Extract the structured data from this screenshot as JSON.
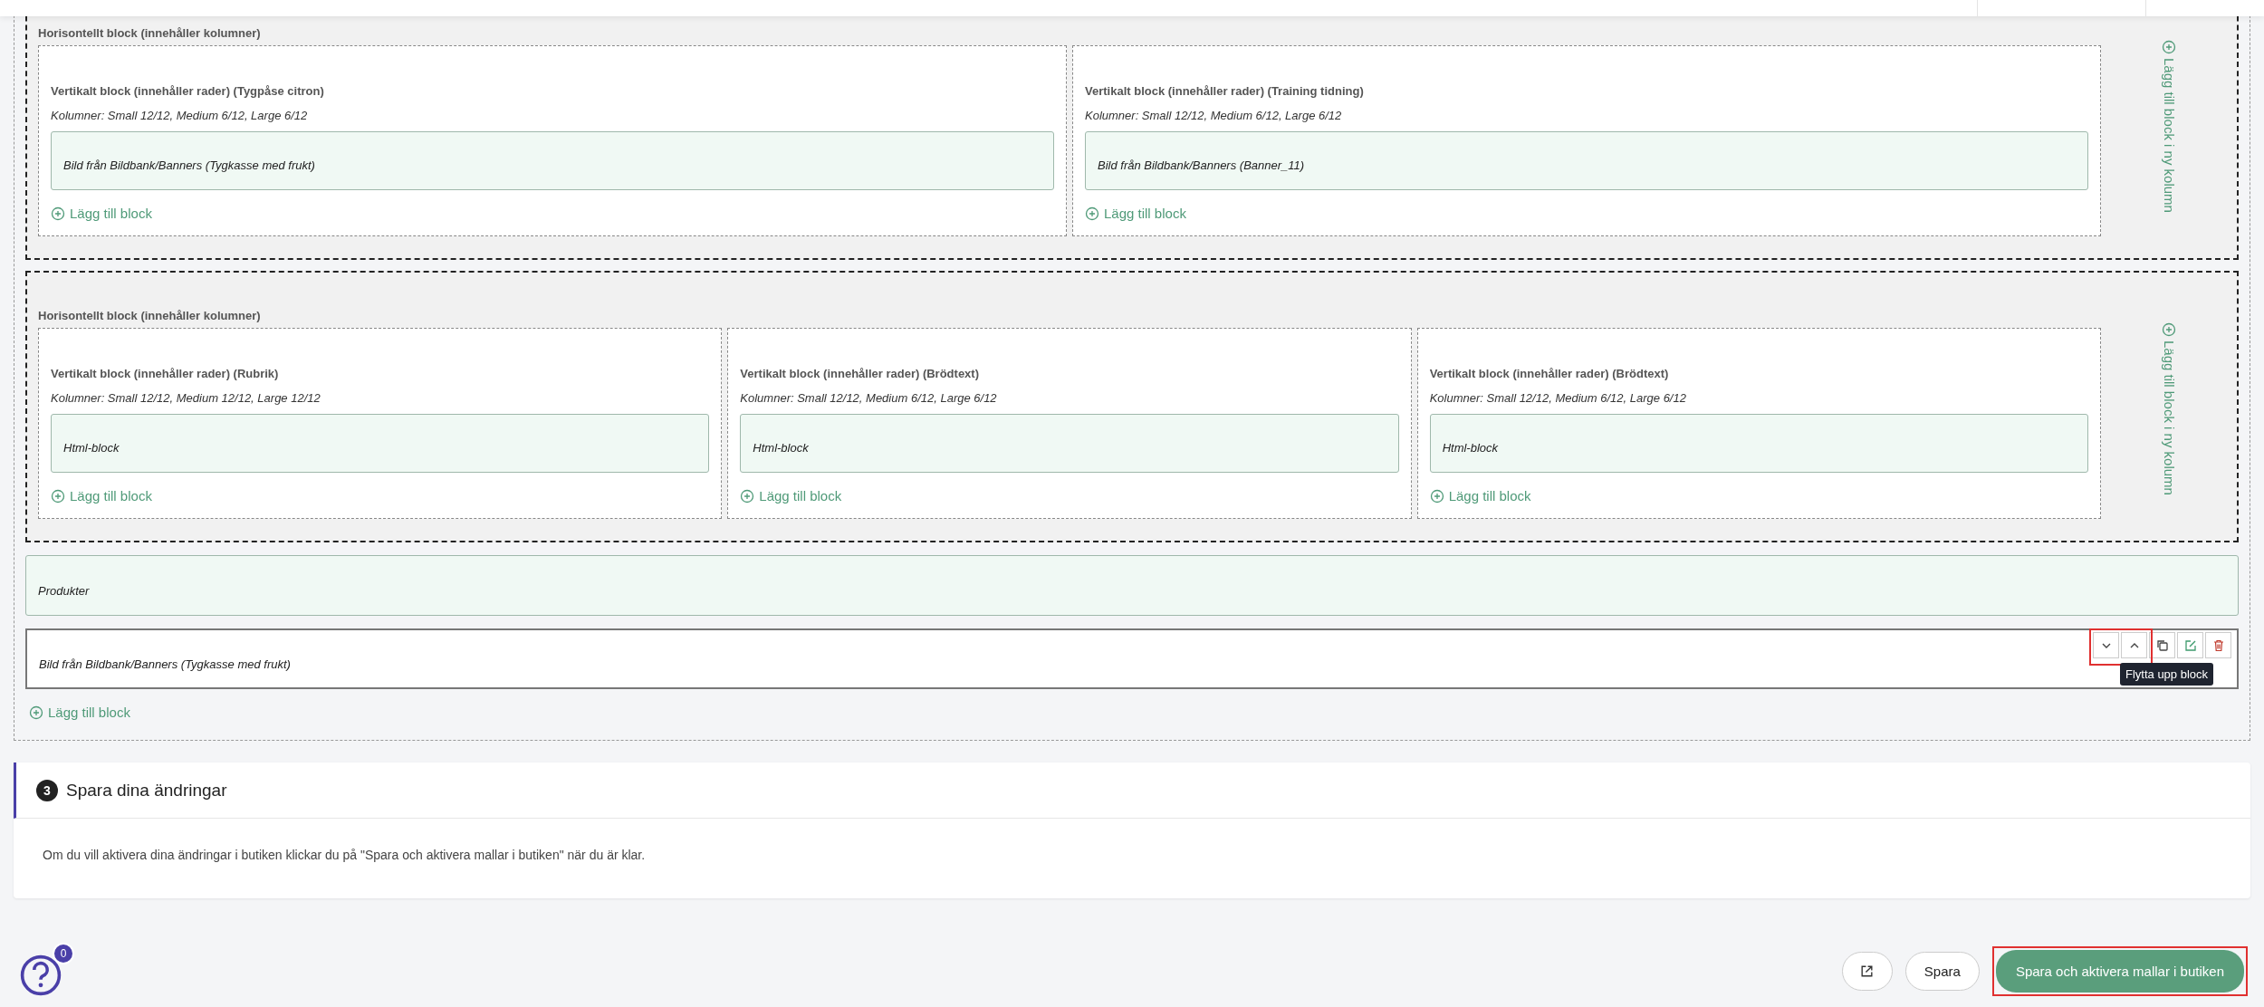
{
  "horizontal_blocks": [
    {
      "label": "Horisontellt block (innehåller kolumner)",
      "add_column_label": "Lägg till block i ny kolumn",
      "columns": [
        {
          "title": "Vertikalt block (innehåller rader) (Tygpåse citron)",
          "columns_info": "Kolumner: Small 12/12, Medium 6/12, Large 6/12",
          "items": [
            "Bild från Bildbank/Banners (Tygkasse med frukt)"
          ],
          "add_label": "Lägg till block"
        },
        {
          "title": "Vertikalt block (innehåller rader) (Training tidning)",
          "columns_info": "Kolumner: Small 12/12, Medium 6/12, Large 6/12",
          "items": [
            "Bild från Bildbank/Banners (Banner_11)"
          ],
          "add_label": "Lägg till block"
        }
      ]
    },
    {
      "label": "Horisontellt block (innehåller kolumner)",
      "add_column_label": "Lägg till block i ny kolumn",
      "columns": [
        {
          "title": "Vertikalt block (innehåller rader) (Rubrik)",
          "columns_info": "Kolumner: Small 12/12, Medium 12/12, Large 12/12",
          "items": [
            "Html-block"
          ],
          "add_label": "Lägg till block"
        },
        {
          "title": "Vertikalt block (innehåller rader) (Brödtext)",
          "columns_info": "Kolumner: Small 12/12, Medium 6/12, Large 6/12",
          "items": [
            "Html-block"
          ],
          "add_label": "Lägg till block"
        },
        {
          "title": "Vertikalt block (innehåller rader) (Brödtext)",
          "columns_info": "Kolumner: Small 12/12, Medium 6/12, Large 6/12",
          "items": [
            "Html-block"
          ],
          "add_label": "Lägg till block"
        }
      ]
    }
  ],
  "rows": [
    {
      "text": "Produkter",
      "selected": false
    },
    {
      "text": "Bild från Bildbank/Banners (Tygkasse med frukt)",
      "selected": true,
      "tooltip": "Flytta upp block"
    }
  ],
  "add_block_label": "Lägg till block",
  "section": {
    "number": "3",
    "title": "Spara dina ändringar",
    "text": "Om du vill aktivera dina ändringar i butiken klickar du på \"Spara och aktivera mallar i butiken\" när du är klar."
  },
  "footer": {
    "help_badge": "0",
    "buttons": [
      {
        "kind": "icon"
      },
      {
        "kind": "secondary",
        "label": "Spara"
      },
      {
        "kind": "primary",
        "label": "Spara och aktivera mallar i butiken"
      }
    ]
  }
}
